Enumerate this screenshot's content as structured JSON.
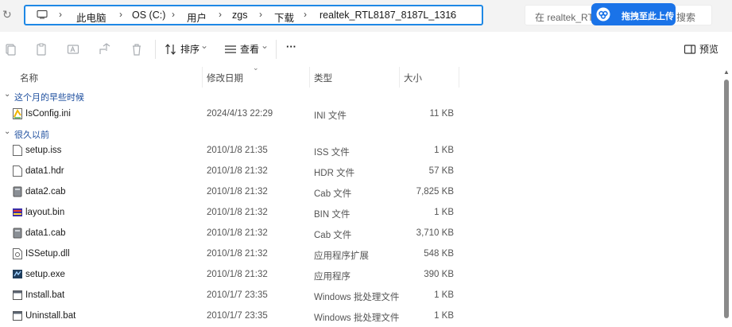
{
  "address": {
    "back_label": "↻",
    "crumbs": [
      "此电脑",
      "OS (C:)",
      "用户",
      "zgs",
      "下载",
      "realtek_RTL8187_8187L_1316"
    ],
    "separator": "›"
  },
  "search": {
    "prefix": "在 realtek_RTL",
    "suffix": "搜索"
  },
  "upload_overlay": {
    "label": "拖拽至此上传"
  },
  "toolbar": {
    "sort_label": "排序",
    "view_label": "查看",
    "more_label": "···",
    "preview_label": "预览",
    "dropdown_caret": "⌄"
  },
  "columns": {
    "name": "名称",
    "date": "修改日期",
    "type": "类型",
    "size": "大小"
  },
  "groups": [
    {
      "label": "这个月的早些时候",
      "files": [
        {
          "name": "IsConfig.ini",
          "date": "2024/4/13 22:29",
          "type": "INI 文件",
          "size": "11 KB",
          "icon": "ini-file-icon"
        }
      ]
    },
    {
      "label": "很久以前",
      "files": [
        {
          "name": "setup.iss",
          "date": "2010/1/8 21:35",
          "type": "ISS 文件",
          "size": "1 KB",
          "icon": "file-icon"
        },
        {
          "name": "data1.hdr",
          "date": "2010/1/8 21:32",
          "type": "HDR 文件",
          "size": "57 KB",
          "icon": "file-icon"
        },
        {
          "name": "data2.cab",
          "date": "2010/1/8 21:32",
          "type": "Cab 文件",
          "size": "7,825 KB",
          "icon": "cab-file-icon"
        },
        {
          "name": "layout.bin",
          "date": "2010/1/8 21:32",
          "type": "BIN 文件",
          "size": "1 KB",
          "icon": "hex-bin-file-icon"
        },
        {
          "name": "data1.cab",
          "date": "2010/1/8 21:32",
          "type": "Cab 文件",
          "size": "3,710 KB",
          "icon": "cab-file-icon"
        },
        {
          "name": "ISSetup.dll",
          "date": "2010/1/8 21:32",
          "type": "应用程序扩展",
          "size": "548 KB",
          "icon": "dll-file-icon"
        },
        {
          "name": "setup.exe",
          "date": "2010/1/8 21:32",
          "type": "应用程序",
          "size": "390 KB",
          "icon": "exe-file-icon"
        },
        {
          "name": "Install.bat",
          "date": "2010/1/7 23:35",
          "type": "Windows 批处理文件",
          "size": "1 KB",
          "icon": "bat-file-icon"
        },
        {
          "name": "Uninstall.bat",
          "date": "2010/1/7 23:35",
          "type": "Windows 批处理文件",
          "size": "1 KB",
          "icon": "bat-file-icon"
        }
      ]
    }
  ],
  "colors": {
    "accent": "#1e88e5",
    "upload_blue": "#1a73e8",
    "group_label": "#1d4e9e"
  }
}
